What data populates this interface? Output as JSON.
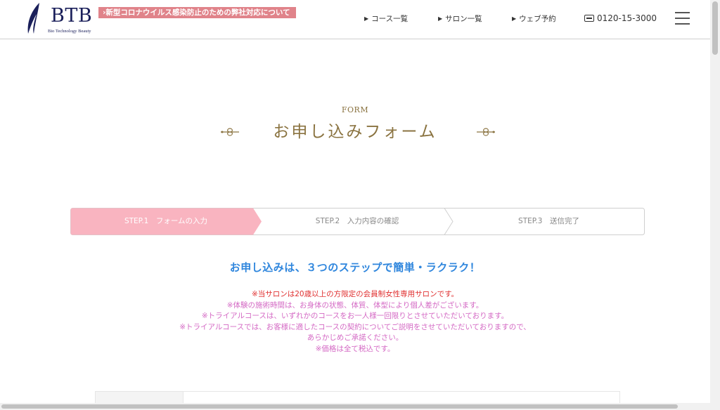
{
  "header": {
    "logo": {
      "mark": "BTB",
      "subtitle": "Bio Technology Beauty"
    },
    "covid_notice": "新型コロナウイルス感染防止のための弊社対応について",
    "nav": [
      {
        "label": "コース一覧"
      },
      {
        "label": "サロン一覧"
      },
      {
        "label": "ウェブ予約"
      }
    ],
    "phone": "0120-15-3000"
  },
  "form": {
    "eyebrow": "FORM",
    "title": "お申し込みフォーム"
  },
  "steps": [
    {
      "label": "STEP.1　フォームの入力",
      "active": true
    },
    {
      "label": "STEP.2　入力内容の確認",
      "active": false
    },
    {
      "label": "STEP.3　送信完了",
      "active": false
    }
  ],
  "intro": "お申し込みは、３つのステップで簡単・ラクラク！",
  "notes": [
    "※当サロンは20歳以上の方限定の会員制女性専用サロンです。",
    "※体験の施術時間は、お身体の状態、体質、体型により個人差がございます。",
    "※トライアルコースは、いずれかのコースをお一人様一回限りとさせていただいております。",
    "※トライアルコースでは、お客様に適したコースの契約についてご説明をさせていただいておりますので、",
    "あらかじめご承諾ください。",
    "※価格は全て税込です。"
  ],
  "colors": {
    "accent_gold": "#8a7340",
    "step_active": "#f9b4c0",
    "intro_blue": "#2f86dd",
    "note_red": "#e03030",
    "note_pink": "#d469c4",
    "notice_bg": "#e0838a"
  },
  "icons": {
    "nav_arrow": "triangle-right-icon",
    "phone": "free-dial-icon",
    "menu": "hamburger-menu-icon",
    "ornament": "flourish-ornament-icon"
  }
}
